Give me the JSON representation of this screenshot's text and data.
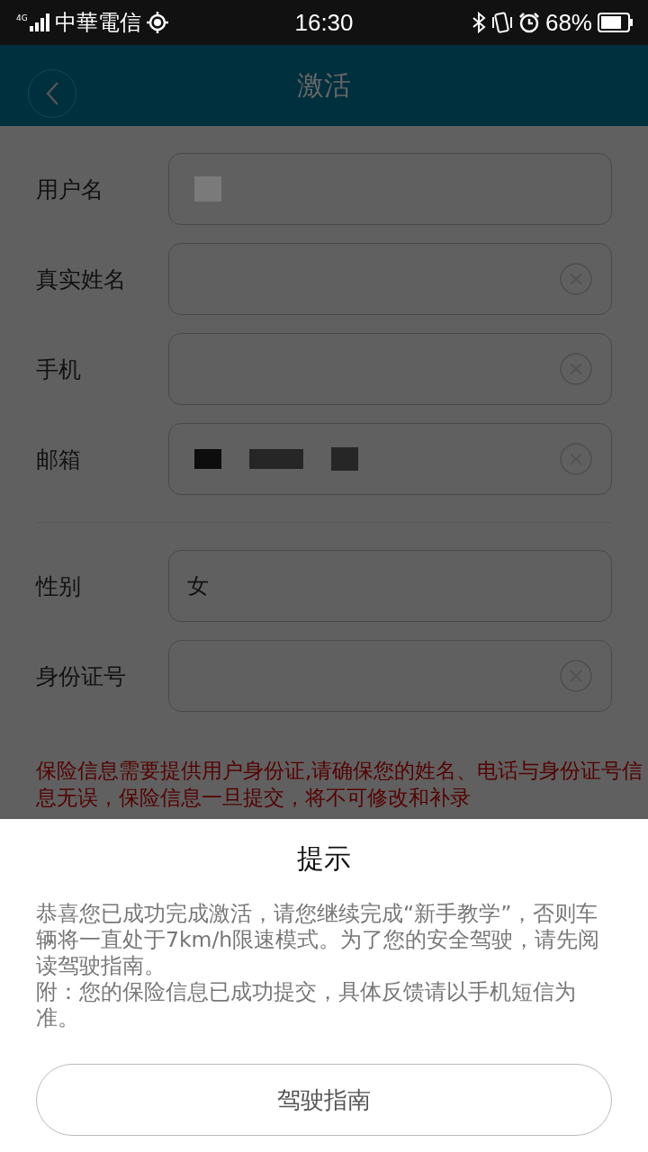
{
  "status_bar": {
    "network": "4G",
    "carrier": "中華電信",
    "time": "16:30",
    "battery": "68%"
  },
  "header": {
    "title": "激活"
  },
  "fields": [
    {
      "label": "用户名",
      "kind": "masked-short",
      "clear_button": false
    },
    {
      "label": "真实姓名",
      "kind": "empty",
      "clear_button": true
    },
    {
      "label": "手机",
      "kind": "empty",
      "clear_button": true
    },
    {
      "label": "邮箱",
      "kind": "masked-long",
      "clear_button": true
    },
    {
      "label": "性别",
      "kind": "text",
      "value": "女",
      "clear_button": false
    },
    {
      "label": "身份证号",
      "kind": "empty",
      "clear_button": true
    }
  ],
  "warning": "保险信息需要提供用户身份证,请确保您的姓名、电话与身份证号信息无误，保险信息一旦提交，将不可修改和补录",
  "dialog": {
    "title": "提示",
    "message": "恭喜您已成功完成激活，请您继续完成“新手教学”，否则车辆将一直处于7km/h限速模式。为了您的安全驾驶，请先阅读驾驶指南。",
    "note": "附：您的保险信息已成功提交，具体反馈请以手机短信为准。",
    "button": "驾驶指南"
  }
}
